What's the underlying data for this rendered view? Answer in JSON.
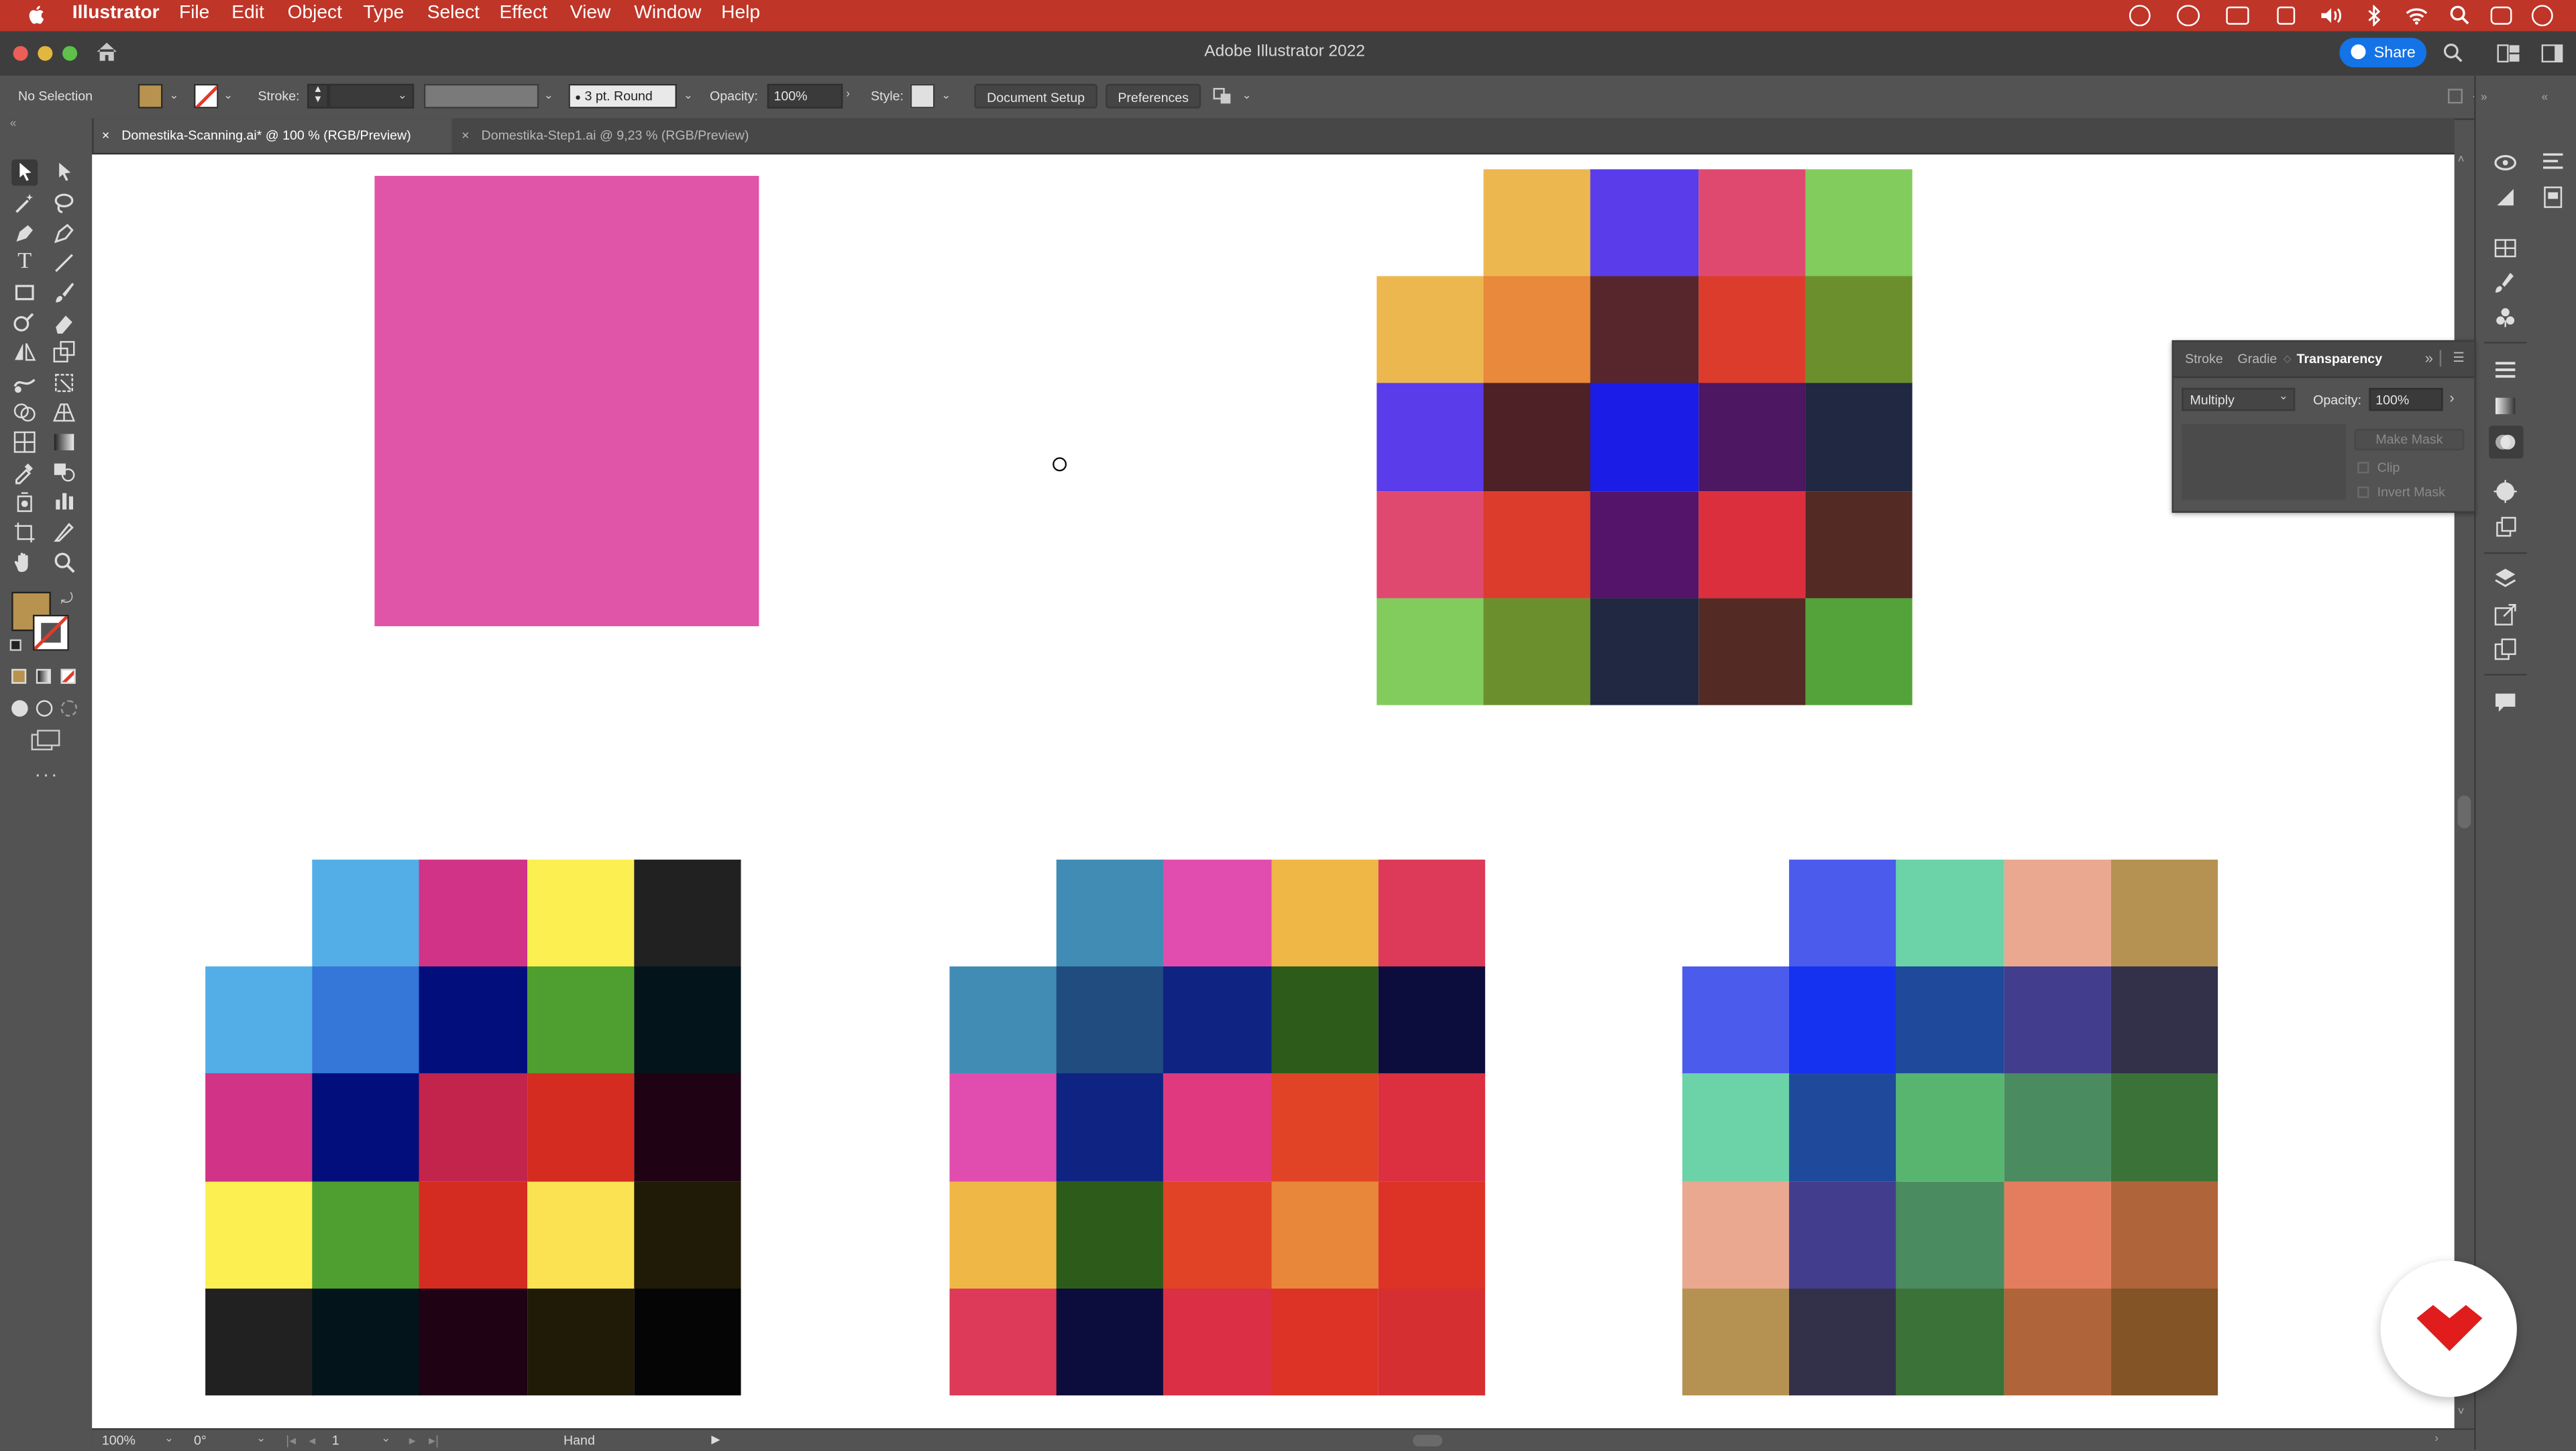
{
  "menubar": {
    "app_name": "Illustrator",
    "items": [
      "File",
      "Edit",
      "Object",
      "Type",
      "Select",
      "Effect",
      "View",
      "Window",
      "Help"
    ]
  },
  "window": {
    "title": "Adobe Illustrator 2022",
    "share_label": "Share"
  },
  "controlbar": {
    "selection_label": "No Selection",
    "stroke_label": "Stroke:",
    "brush_value": "3 pt. Round",
    "opacity_label": "Opacity:",
    "opacity_value": "100%",
    "style_label": "Style:",
    "document_setup_label": "Document Setup",
    "preferences_label": "Preferences"
  },
  "tabs": [
    {
      "label": "Domestika-Scanning.ai* @ 100 % (RGB/Preview)",
      "active": true
    },
    {
      "label": "Domestika-Step1.ai @ 9,23 % (RGB/Preview)",
      "active": false
    }
  ],
  "colors": {
    "fill_swatch": "#b8934f",
    "accent_menubar": "#bf3528",
    "pink_rect": "#e055a8"
  },
  "artboard": {
    "pink_rectangle_color": "#e055a8",
    "grids": [
      {
        "name": "grid-top-right",
        "top_row": [
          "#edb750",
          "#5a3ceb",
          "#e0496f",
          "#82cb5d"
        ],
        "rows": [
          [
            "#edb750",
            "#e8893b",
            "#57262c",
            "#dc3c2c",
            "#6c8f2e"
          ],
          [
            "#5a3ceb",
            "#4e2126",
            "#1b1de6",
            "#4d1761",
            "#212842"
          ],
          [
            "#e0496f",
            "#dc3c2c",
            "#531469",
            "#dc2f3d",
            "#532a24"
          ],
          [
            "#82cb5d",
            "#6c8f2e",
            "#212842",
            "#532a24",
            "#53a33a"
          ]
        ]
      },
      {
        "name": "grid-bottom-left",
        "top_row": [
          "#53aee8",
          "#d13387",
          "#fbef52",
          "#212121"
        ],
        "rows": [
          [
            "#53aee8",
            "#3477d8",
            "#030e7d",
            "#4e9f30",
            "#04141b"
          ],
          [
            "#d13387",
            "#030e7d",
            "#c3244b",
            "#d52c22",
            "#1f0213"
          ],
          [
            "#fbef52",
            "#4e9f30",
            "#d52c22",
            "#fae253",
            "#201b07"
          ],
          [
            "#212121",
            "#04141b",
            "#1f0213",
            "#201b07",
            "#050505"
          ]
        ]
      },
      {
        "name": "grid-bottom-middle",
        "top_row": [
          "#418cb5",
          "#e04daf",
          "#efb746",
          "#dc3a58"
        ],
        "rows": [
          [
            "#418cb5",
            "#214c80",
            "#0f2382",
            "#2d5c1a",
            "#0c0d3d"
          ],
          [
            "#e04daf",
            "#0f2382",
            "#e0397f",
            "#e14326",
            "#dc2f40"
          ],
          [
            "#efb746",
            "#2d5c1a",
            "#e14326",
            "#e8873a",
            "#dd3226"
          ],
          [
            "#dc3a58",
            "#0c0d3d",
            "#da2f44",
            "#dd3226",
            "#d52f32"
          ]
        ]
      },
      {
        "name": "grid-bottom-right",
        "top_row": [
          "#4b5bec",
          "#6bd3a7",
          "#eaa890",
          "#b69252"
        ],
        "rows": [
          [
            "#4b5bec",
            "#1532f1",
            "#1f4a9b",
            "#423d8d",
            "#33304a"
          ],
          [
            "#6bd3a7",
            "#1f4a9b",
            "#58b570",
            "#4a8b5f",
            "#3b7237"
          ],
          [
            "#eaa890",
            "#423d8d",
            "#4a8b5f",
            "#e47d5d",
            "#b0643a"
          ],
          [
            "#b69252",
            "#33304a",
            "#3b7237",
            "#b0643a",
            "#825426"
          ]
        ]
      }
    ]
  },
  "transparency_panel": {
    "tabs": [
      "Stroke",
      "Gradie",
      "Transparency"
    ],
    "blend_mode": "Multiply",
    "opacity_label": "Opacity:",
    "opacity_value": "100%",
    "make_mask_label": "Make Mask",
    "clip_label": "Clip",
    "invert_mask_label": "Invert Mask"
  },
  "statusbar": {
    "zoom": "100%",
    "rotation": "0°",
    "artboard_number": "1",
    "tool_name": "Hand"
  }
}
